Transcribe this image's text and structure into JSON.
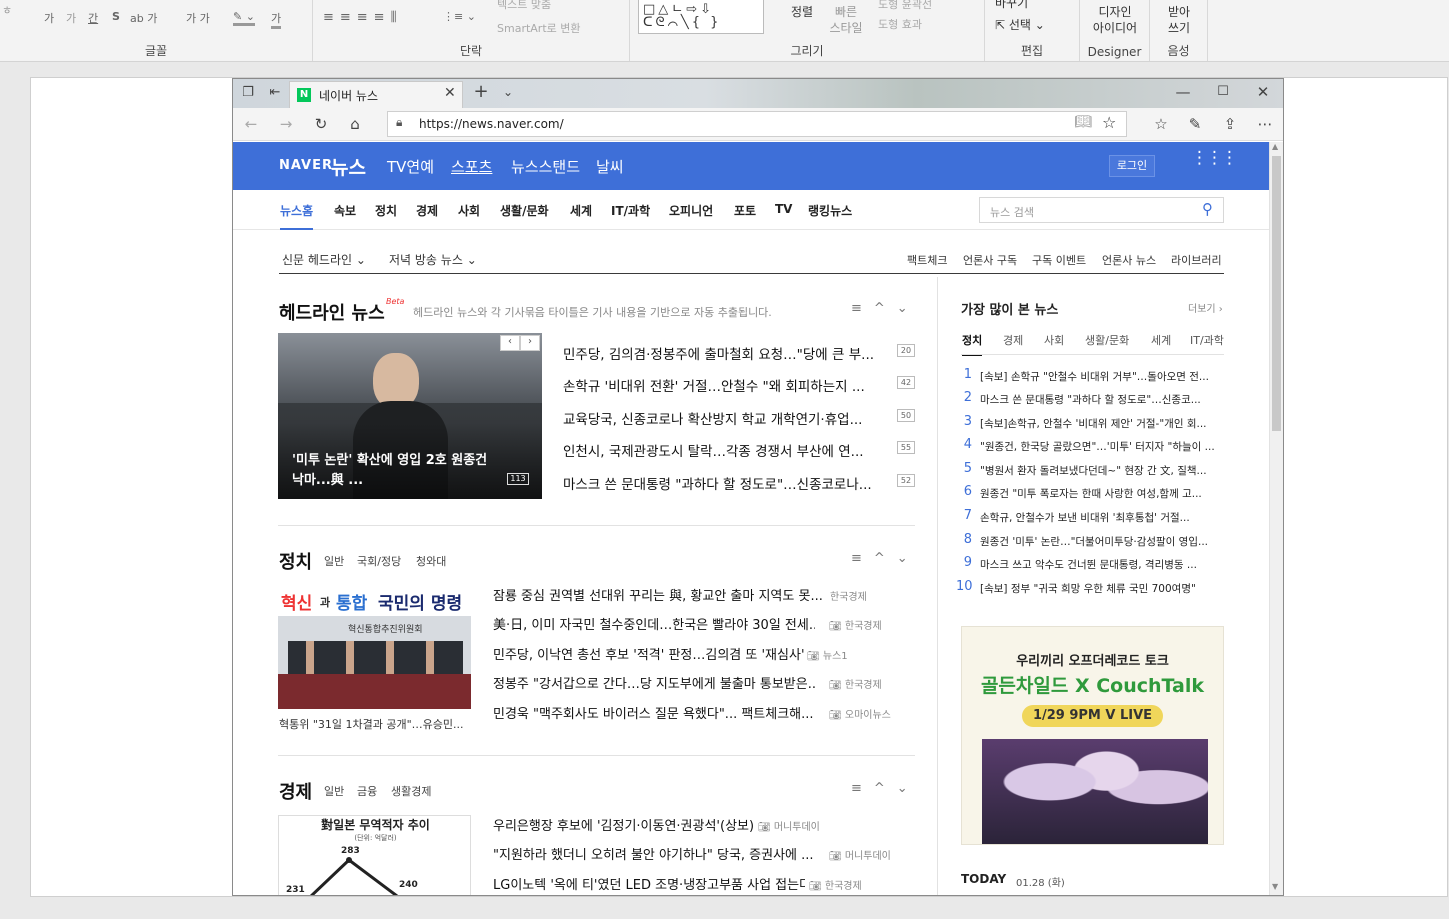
{
  "ribbon": {
    "font_group": {
      "label": "글꼴",
      "buttons": [
        "가",
        "가",
        "간",
        "S",
        "ab 가",
        "가 가",
        "가"
      ]
    },
    "paragraph_group": {
      "label": "단락",
      "text_fit": "텍스트 맞춤",
      "smartart": "SmartArt로 변환"
    },
    "drawing_group": {
      "label": "그리기",
      "arrange": "정렬",
      "quick_styles": "빠른\n스타일",
      "shape_outline": "도형 윤곽선",
      "shape_effects": "도형 효과"
    },
    "editing_group": {
      "label": "편집",
      "replace": "바꾸기",
      "select": "선택"
    },
    "designer_group": {
      "label": "Designer",
      "design_ideas": "디자인\n아이디어"
    },
    "voice_group": {
      "label": "음성",
      "dictate": "받아\n쓰기"
    }
  },
  "browser": {
    "tab_title": "네이버 뉴스",
    "url": "https://news.naver.com/",
    "new_tab": "+"
  },
  "naver": {
    "logo_naver": "NAVER",
    "logo_news": "뉴스",
    "gnb": [
      "TV연예",
      "스포츠",
      "뉴스스탠드",
      "날씨"
    ],
    "login": "로그인",
    "lnb": [
      "뉴스홈",
      "속보",
      "정치",
      "경제",
      "사회",
      "생활/문화",
      "세계",
      "IT/과학",
      "오피니언",
      "포토",
      "TV",
      "랭킹뉴스"
    ],
    "search_placeholder": "뉴스 검색",
    "subnav_left": [
      "신문 헤드라인",
      "저녁 방송 뉴스"
    ],
    "subnav_right": [
      "팩트체크",
      "언론사 구독",
      "구독 이벤트",
      "언론사 뉴스",
      "라이브러리"
    ]
  },
  "headline": {
    "title": "헤드라인 뉴스",
    "beta": "Beta",
    "desc": "헤드라인 뉴스와 각 기사묶음 타이틀은 기사 내용을 기반으로 자동 추출됩니다.",
    "photo_caption": "'미투 논란' 확산에 영입 2호 원종건 낙마...與 ...",
    "photo_count": "113",
    "items": [
      {
        "text": "민주당, 김의겸·정봉주에 출마철회 요청…\"당에 큰 부...",
        "count": "20"
      },
      {
        "text": "손학규 '비대위 전환' 거절…안철수 \"왜 회피하는지 ...",
        "count": "42"
      },
      {
        "text": "교육당국, 신종코로나 확산방지 학교 개학연기·휴업...",
        "count": "50"
      },
      {
        "text": "인천시, 국제관광도시 탈락…각종 경쟁서 부산에 연...",
        "count": "55"
      },
      {
        "text": "마스크 쓴 문대통령 \"과하다 할 정도로\"…신종코로나...",
        "count": "52"
      }
    ]
  },
  "politics": {
    "title": "정치",
    "subs": [
      "일반",
      "국회/정당",
      "청와대"
    ],
    "photo_banner_1": "혁신",
    "photo_banner_2": "과",
    "photo_banner_3": "통합",
    "photo_banner_4": "국민의 명령",
    "photo_banner_sub": "혁신통합추진위원회",
    "photo_caption": "혁통위 \"31일 1차결과 공개\"…유승민...",
    "items": [
      {
        "text": "잠룡 중심 권역별 선대위 꾸리는 與, 황교안 출마 지역도 못...",
        "press": "한국경제"
      },
      {
        "text": "美·日, 이미 자국민 철수중인데…한국은 빨라야 30일 전세...",
        "press": "한국경제"
      },
      {
        "text": "민주당, 이낙연 총선 후보 '적격' 판정…김의겸 또 '재심사'",
        "press": "뉴스1"
      },
      {
        "text": "정봉주 \"강서갑으로 간다…당 지도부에게 불출마 통보받은...",
        "press": "한국경제"
      },
      {
        "text": "민경욱 \"맥주회사도 바이러스 질문 욕했다\"... 팩트체크해...",
        "press": "오마이뉴스"
      }
    ]
  },
  "economy": {
    "title": "경제",
    "subs": [
      "일반",
      "금융",
      "생활경제"
    ],
    "chart_title": "對일본 무역적자 추이",
    "chart_unit": "(단위: 억달러)",
    "chart_labels": [
      "231",
      "283",
      "240"
    ],
    "items": [
      {
        "text": "우리은행장 후보에 '김정기·이동연·권광석'(상보)",
        "press": "머니투데이"
      },
      {
        "text": "\"지원하라 했더니 오히려 불안 야기하나\" 당국, 증권사에 ...",
        "press": "머니투데이"
      },
      {
        "text": "LG이노텍 '옥에 티'였던 LED 조명·냉장고부품 사업 접는다",
        "press": "한국경제"
      }
    ]
  },
  "ranking": {
    "title": "가장 많이 본 뉴스",
    "more": "더보기",
    "tabs": [
      "정치",
      "경제",
      "사회",
      "생활/문화",
      "세계",
      "IT/과학"
    ],
    "items": [
      {
        "n": "1",
        "text": "[속보] 손학규 \"안철수 비대위 거부\"…돌아오면 전..."
      },
      {
        "n": "2",
        "text": "마스크 쓴 문대통령 \"과하다 할 정도로\"…신종코..."
      },
      {
        "n": "3",
        "text": "[속보]손학규, 안철수 '비대위 제안' 거절-\"개인 회..."
      },
      {
        "n": "4",
        "text": "\"원종건, 한국당 골랐으면\"…'미투' 터지자 \"하늘이 ..."
      },
      {
        "n": "5",
        "text": "\"병원서 환자 돌려보냈다던데~\" 현장 간 文, 질책..."
      },
      {
        "n": "6",
        "text": "원종건 \"미투 폭로자는 한때 사랑한 여성,함께 고..."
      },
      {
        "n": "7",
        "text": "손학규, 안철수가 보낸 비대위 '최후통첩' 거절..."
      },
      {
        "n": "8",
        "text": "원종건 '미투' 논란…\"더불어미투당·감성팔이 영입..."
      },
      {
        "n": "9",
        "text": "마스크 쓰고 악수도 건너뛴 문대통령, 격리병동 ..."
      },
      {
        "n": "10",
        "text": "[속보] 정부 \"귀국 희망 우한 체류 국민 700여명\""
      }
    ]
  },
  "ad": {
    "line1": "우리끼리 오프더레코드 토크",
    "line2": "골든차일드 X CouchTalk",
    "line3": "1/29 9PM V LIVE"
  },
  "today": {
    "label": "TODAY",
    "date": "01.28 (화)"
  },
  "colors": {
    "naver_blue": "#3e6fd8",
    "naver_green": "#03c75a",
    "ad_green": "#2f9a3c",
    "ad_yellow": "#f0d65a"
  }
}
